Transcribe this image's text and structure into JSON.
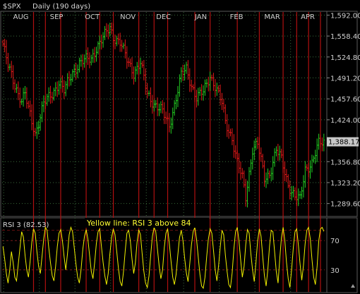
{
  "header": {
    "symbol": "$SPX",
    "period": "Daily (190 days)"
  },
  "rsi_panel": {
    "title": "RSI 3 (82.53)",
    "annotation": "Yellow line: RSI 3 above 84"
  },
  "colors": {
    "background": "#000000",
    "up_bar": "#22cc22",
    "down_bar": "#e01818",
    "rsi_line": "#f0f000",
    "signal_line": "#b01010",
    "grid": "#3a6a3a",
    "text": "#cfcfcf",
    "last_price_box": "#c8c8c8"
  },
  "icons": [
    "scroll-triangle-icon"
  ],
  "chart_data": [
    {
      "type": "candlestick",
      "title": "$SPX Daily (190 days)",
      "x_month_labels": [
        "AUG",
        "SEP",
        "OCT",
        "NOV",
        "DEC",
        "JAN",
        "FEB",
        "MAR",
        "APR"
      ],
      "y_tick_labels": [
        "1,592.00",
        "1,558.40",
        "1,524.80",
        "1,491.20",
        "1,457.60",
        "1,424.00",
        "1,356.80",
        "1,323.20",
        "1,289.60"
      ],
      "y_ticks": [
        1592,
        1558.4,
        1524.8,
        1491.2,
        1457.6,
        1424,
        1356.8,
        1323.2,
        1289.6
      ],
      "ylim": [
        1270,
        1597
      ],
      "last_price_label": "1,388.17",
      "last_price": 1388.17,
      "grid": true,
      "close_path": [
        [
          0,
          1545
        ],
        [
          3,
          1510
        ],
        [
          7,
          1480
        ],
        [
          11,
          1455
        ],
        [
          13,
          1465
        ],
        [
          15,
          1440
        ],
        [
          19,
          1402
        ],
        [
          24,
          1450
        ],
        [
          29,
          1465
        ],
        [
          33,
          1485
        ],
        [
          36,
          1470
        ],
        [
          41,
          1500
        ],
        [
          45,
          1515
        ],
        [
          49,
          1520
        ],
        [
          52,
          1522
        ],
        [
          55,
          1540
        ],
        [
          59,
          1555
        ],
        [
          63,
          1572
        ],
        [
          65,
          1558
        ],
        [
          69,
          1548
        ],
        [
          73,
          1520
        ],
        [
          77,
          1500
        ],
        [
          81,
          1515
        ],
        [
          85,
          1465
        ],
        [
          89,
          1450
        ],
        [
          93,
          1440
        ],
        [
          98,
          1415
        ],
        [
          102,
          1460
        ],
        [
          105,
          1495
        ],
        [
          108,
          1505
        ],
        [
          111,
          1480
        ],
        [
          114,
          1460
        ],
        [
          118,
          1468
        ],
        [
          122,
          1495
        ],
        [
          125,
          1478
        ],
        [
          129,
          1450
        ],
        [
          131,
          1420
        ],
        [
          135,
          1395
        ],
        [
          138,
          1355
        ],
        [
          141,
          1330
        ],
        [
          143,
          1300
        ],
        [
          147,
          1378
        ],
        [
          150,
          1385
        ],
        [
          154,
          1330
        ],
        [
          157,
          1338
        ],
        [
          161,
          1375
        ],
        [
          164,
          1360
        ],
        [
          168,
          1320
        ],
        [
          172,
          1300
        ],
        [
          175,
          1295
        ],
        [
          178,
          1345
        ],
        [
          182,
          1355
        ],
        [
          186,
          1385
        ],
        [
          189,
          1388
        ]
      ]
    },
    {
      "type": "line",
      "title": "RSI 3 (82.53)",
      "y_tick_labels": [
        "70",
        "30"
      ],
      "y_ticks": [
        70,
        30
      ],
      "ylim": [
        0,
        100
      ],
      "threshold": 84,
      "series": [
        {
          "name": "RSI 3",
          "values": [
            62,
            45,
            25,
            12,
            30,
            55,
            40,
            20,
            15,
            38,
            60,
            82,
            75,
            50,
            30,
            20,
            42,
            68,
            86,
            80,
            55,
            35,
            25,
            48,
            72,
            88,
            84,
            60,
            40,
            22,
            15,
            35,
            62,
            80,
            85,
            70,
            48,
            30,
            52,
            78,
            88,
            82,
            60,
            38,
            20,
            12,
            30,
            58,
            76,
            85,
            72,
            50,
            28,
            18,
            40,
            66,
            82,
            86,
            62,
            40,
            22,
            10,
            25,
            52,
            74,
            86,
            78,
            55,
            32,
            14,
            8,
            28,
            56,
            80,
            84,
            70,
            45,
            25,
            40,
            68,
            85,
            78,
            52,
            28,
            12,
            6,
            22,
            50,
            76,
            88,
            82,
            58,
            35,
            18,
            30,
            60,
            80,
            86,
            66,
            42,
            20,
            10,
            24,
            50,
            74,
            84,
            70,
            46,
            26,
            14,
            38,
            64,
            82,
            88,
            72,
            48,
            24,
            8,
            5,
            20,
            48,
            72,
            86,
            80,
            56,
            30,
            15,
            36,
            62,
            84,
            78,
            50,
            28,
            10,
            6,
            26,
            58,
            82,
            88,
            70,
            44,
            20,
            35,
            65,
            85,
            80,
            52,
            30,
            14,
            40,
            70,
            86,
            76,
            48,
            22,
            8,
            30,
            62,
            84,
            82,
            55,
            28,
            12,
            45,
            74,
            88,
            70,
            40,
            18,
            6,
            30,
            60,
            82,
            86,
            64,
            38,
            16,
            36,
            66,
            84,
            88,
            72,
            44,
            20,
            10,
            34,
            70,
            86,
            88,
            82.53
          ]
        }
      ]
    }
  ]
}
